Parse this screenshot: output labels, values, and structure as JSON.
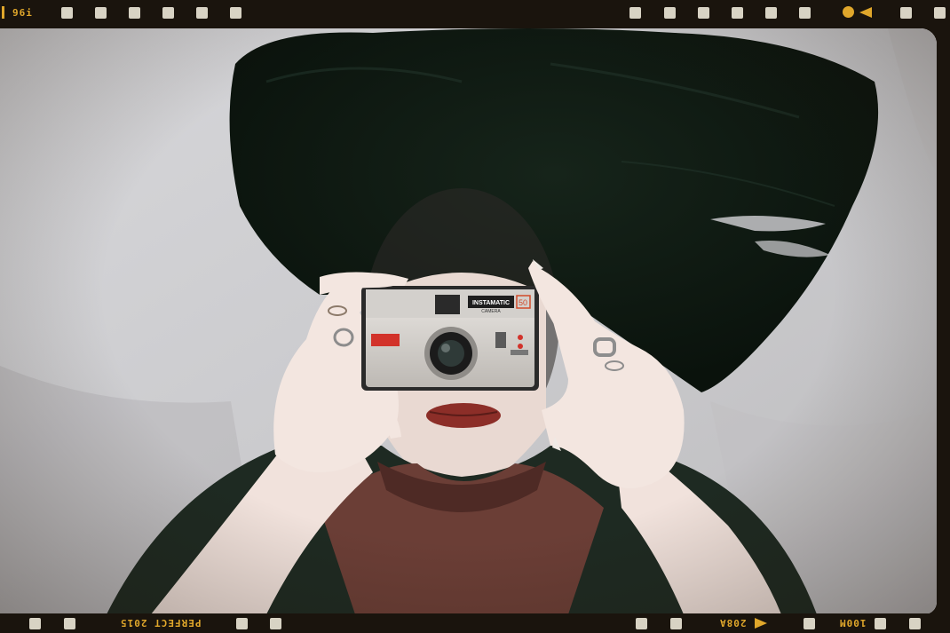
{
  "film_strip": {
    "top_left_code": "96i",
    "bottom_left_text": "PERFECT 2015",
    "bottom_right_code_a": "208A",
    "bottom_right_code_b": "100M"
  },
  "camera": {
    "brand_text": "INSTAMATIC",
    "sub_text": "CAMERA",
    "model": "50"
  },
  "colors": {
    "film_border": "#1a140d",
    "sprocket": "#d8d3c4",
    "film_print": "#e0a72b",
    "pillow": "#cfcfd2",
    "hair": "#0f1a12",
    "sweater": "#1e2a22",
    "shirt": "#6b3e36",
    "skin": "#f1e2dc",
    "lips": "#8c2e28"
  }
}
